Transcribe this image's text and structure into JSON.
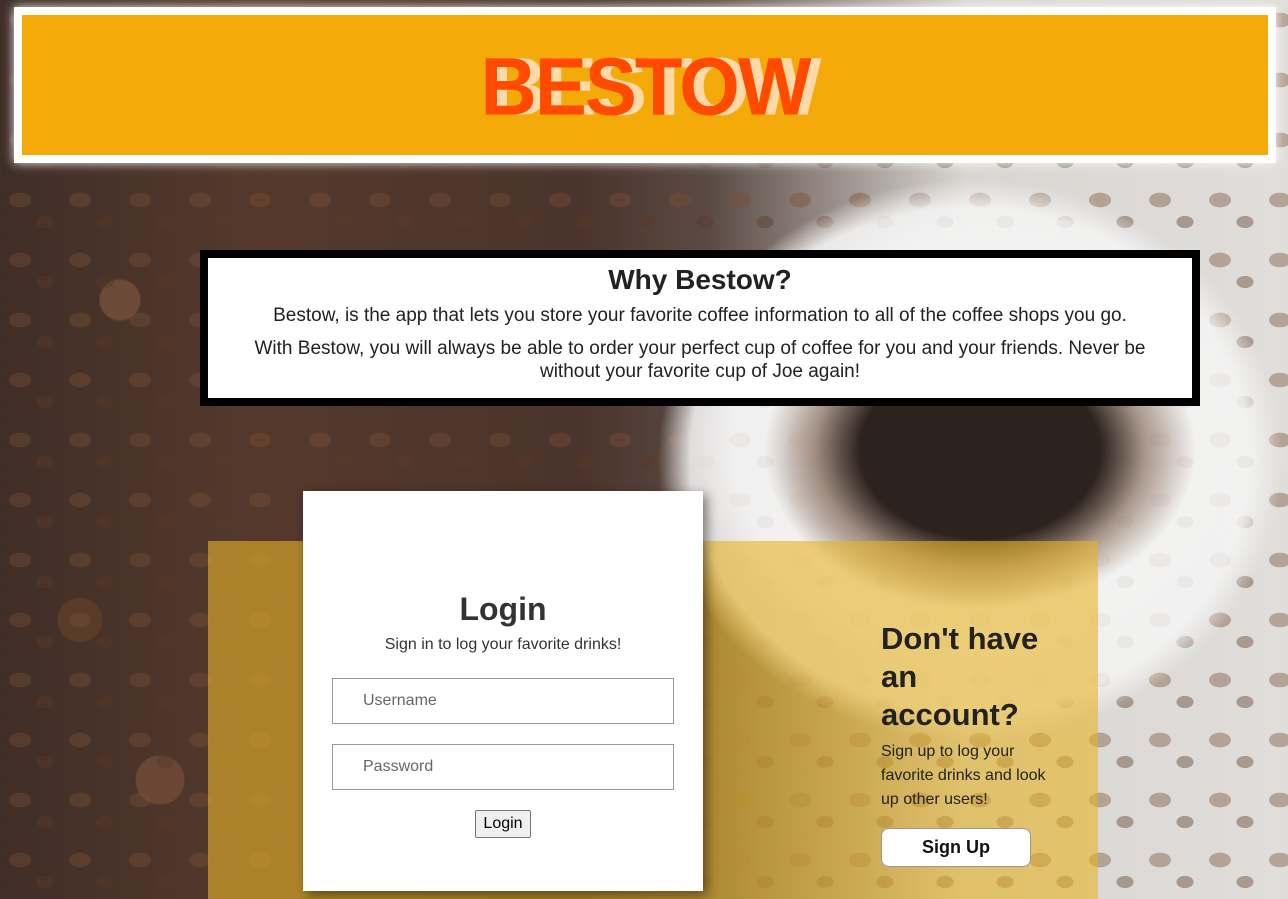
{
  "header": {
    "logo_text": "BESTOW"
  },
  "why": {
    "title": "Why Bestow?",
    "line1": "Bestow, is the app that lets you store your favorite coffee information to all of the coffee shops you go.",
    "line2": "With Bestow, you will always be able to order your perfect cup of coffee for you and your friends. Never be without your favorite cup of Joe again!"
  },
  "login": {
    "title": "Login",
    "subtitle": "Sign in to log your favorite drinks!",
    "username_placeholder": "Username",
    "password_placeholder": "Password",
    "button_label": "Login"
  },
  "signup": {
    "title": "Don't have an account?",
    "text": "Sign up to log your favorite drinks and look up other users!",
    "button_label": "Sign Up"
  },
  "colors": {
    "header_bg": "#f4ab0a",
    "logo": "#ff4a00",
    "panel": "#e6b428"
  }
}
